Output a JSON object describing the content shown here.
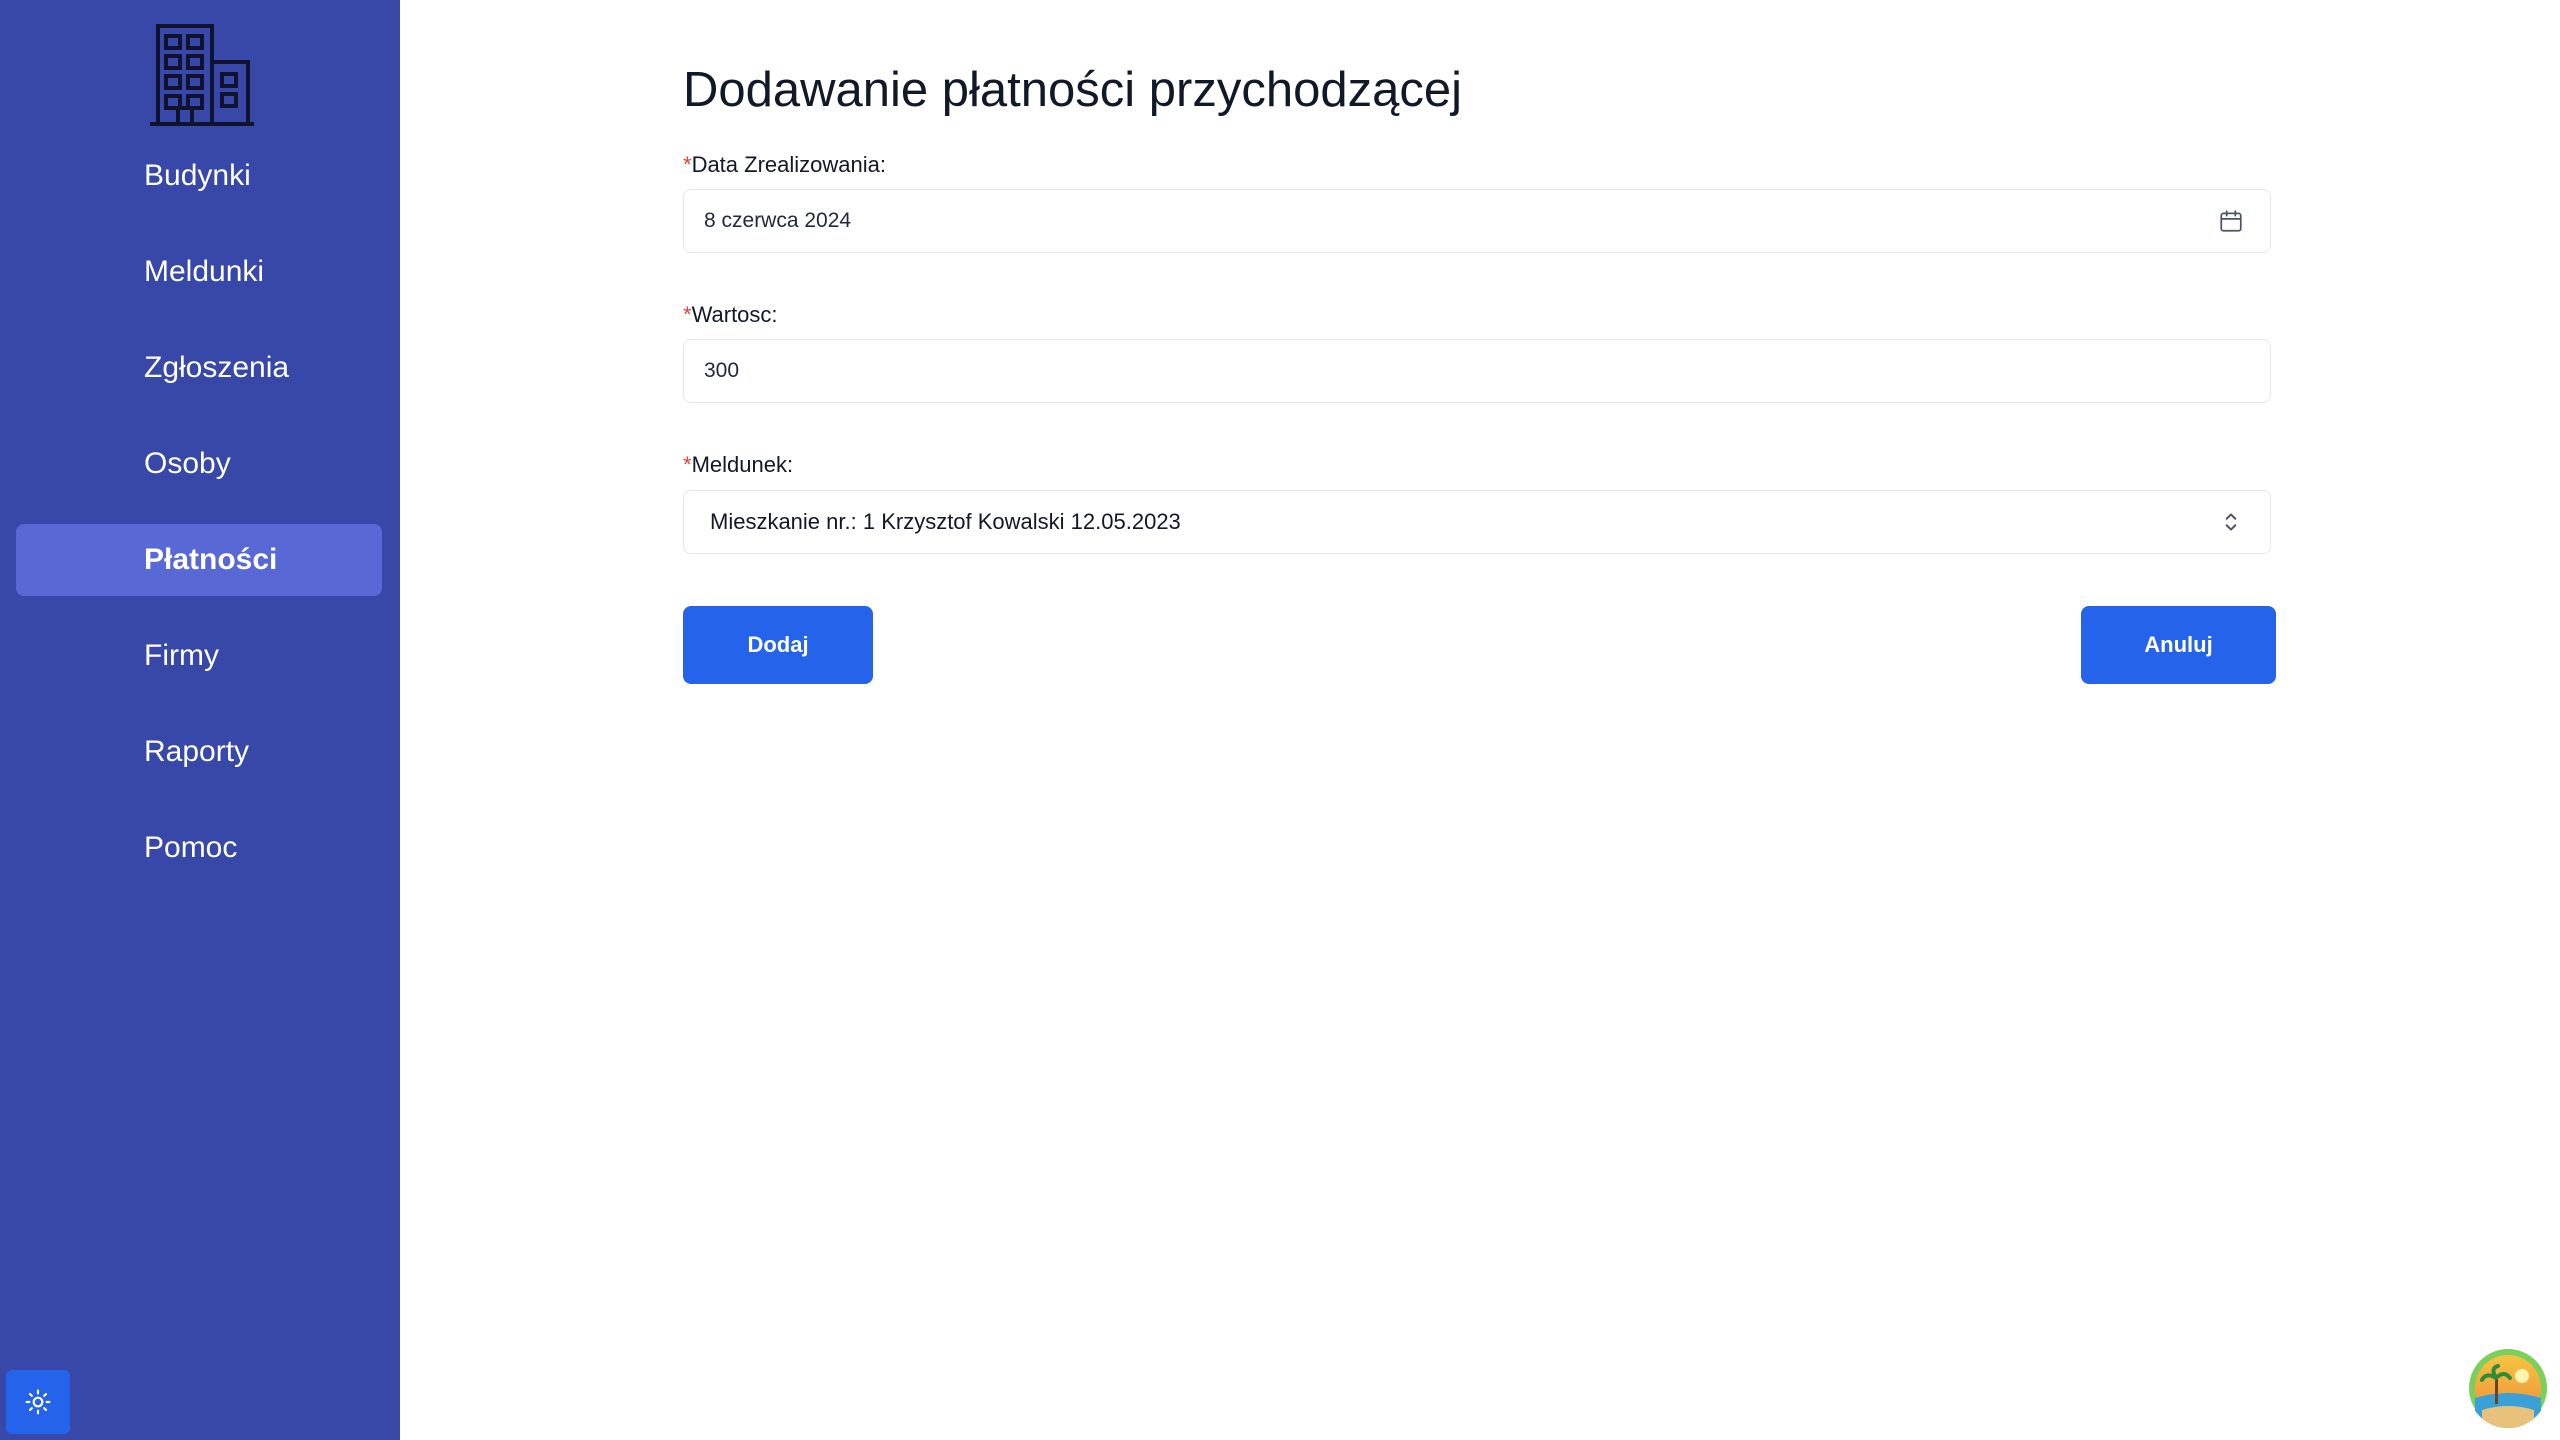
{
  "sidebar": {
    "logo_icon": "building-icon",
    "items": [
      {
        "label": "Budynki",
        "active": false
      },
      {
        "label": "Meldunki",
        "active": false
      },
      {
        "label": "Zgłoszenia",
        "active": false
      },
      {
        "label": "Osoby",
        "active": false
      },
      {
        "label": "Płatności",
        "active": true
      },
      {
        "label": "Firmy",
        "active": false
      },
      {
        "label": "Raporty",
        "active": false
      },
      {
        "label": "Pomoc",
        "active": false
      }
    ],
    "theme_toggle_icon": "sun-icon"
  },
  "form": {
    "title": "Dodawanie płatności przychodzącej",
    "required_marker": "*",
    "date": {
      "label": "Data Zrealizowania:",
      "value": "8 czerwca 2024",
      "icon": "calendar-icon"
    },
    "amount": {
      "label": "Wartosc:",
      "value": "300"
    },
    "checkin": {
      "label": "Meldunek:",
      "selected": "Mieszkanie nr.: 1 Krzysztof Kowalski 12.05.2023",
      "icon": "chevron-up-down-icon"
    },
    "add_button": "Dodaj",
    "cancel_button": "Anuluj"
  },
  "colors": {
    "sidebar_bg": "#3848a8",
    "sidebar_active": "#5868d4",
    "primary": "#2563eb",
    "required": "#e53e3e"
  }
}
